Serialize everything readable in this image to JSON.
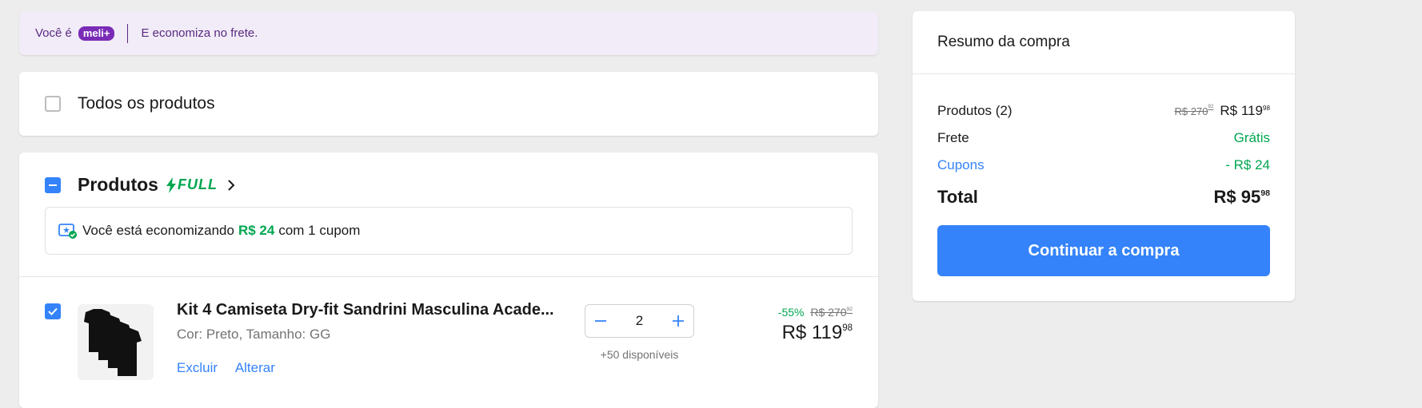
{
  "meli_banner": {
    "prefix": "Você é",
    "badge": "meli+",
    "message": "E economiza no frete."
  },
  "all_products": {
    "label": "Todos os produtos",
    "checked": false
  },
  "products_section": {
    "title": "Produtos",
    "full_tag": "FULL",
    "coupon_prefix": "Você está economizando",
    "coupon_amount": "R$ 24",
    "coupon_suffix": "com 1 cupom"
  },
  "item": {
    "title": "Kit 4 Camiseta Dry-fit Sandrini Masculina Acade...",
    "variant": "Cor: Preto, Tamanho: GG",
    "delete_label": "Excluir",
    "change_label": "Alterar",
    "quantity": "2",
    "available": "+50 disponíveis",
    "discount_pct": "-55%",
    "old_price_int": "R$ 270",
    "old_price_cents": "92",
    "price_int": "R$ 119",
    "price_cents": "98"
  },
  "summary": {
    "title": "Resumo da compra",
    "products_label": "Produtos (2)",
    "products_old_int": "R$ 270",
    "products_old_cents": "92",
    "products_price_int": "R$ 119",
    "products_price_cents": "98",
    "shipping_label": "Frete",
    "shipping_value": "Grátis",
    "coupons_label": "Cupons",
    "coupons_value": "- R$ 24",
    "total_label": "Total",
    "total_int": "R$ 95",
    "total_cents": "98",
    "cta_label": "Continuar a compra"
  },
  "colors": {
    "accent_blue": "#3483fa",
    "success_green": "#00a650",
    "meli_purple": "#7a2bb6"
  }
}
